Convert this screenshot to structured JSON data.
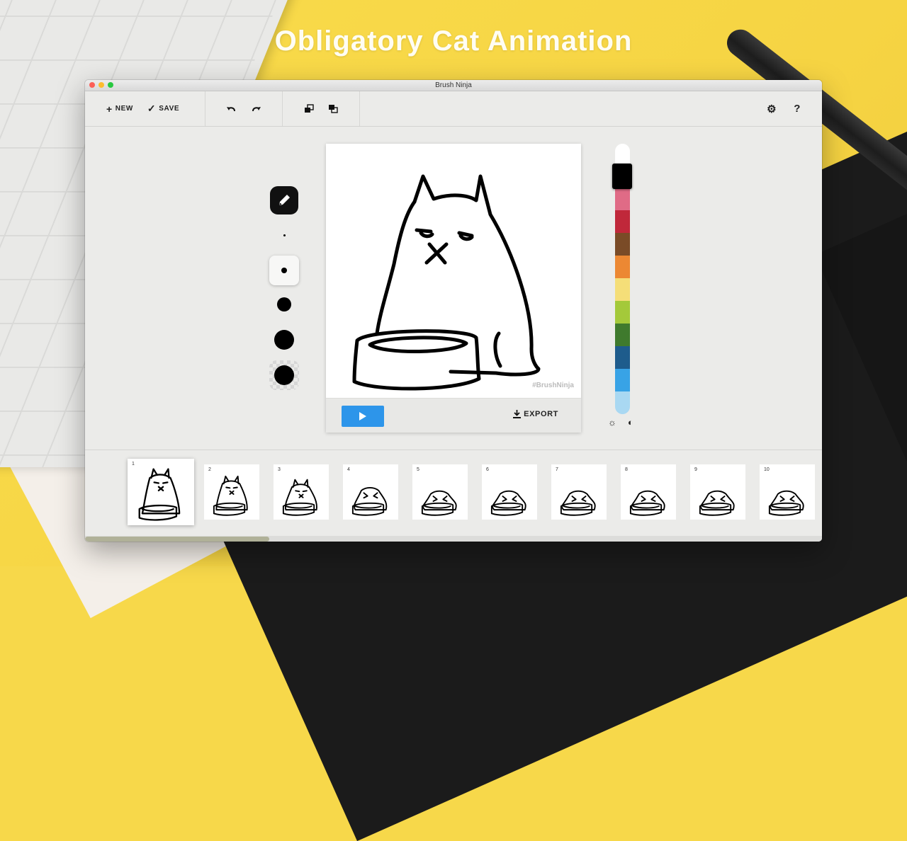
{
  "headline": "Obligatory Cat Animation",
  "window": {
    "title": "Brush Ninja"
  },
  "toolbar": {
    "new_label": "NEW",
    "save_label": "SAVE",
    "undo_icon": "undo-icon",
    "redo_icon": "redo-icon",
    "layer_back_icon": "layer-back-icon",
    "layer_front_icon": "layer-front-icon",
    "settings_icon": "gear-icon",
    "help_label": "?"
  },
  "brushes": {
    "tool": "pencil-icon",
    "sizes": [
      "tiny",
      "small",
      "medium",
      "large",
      "eraser"
    ],
    "selected_size": "small"
  },
  "canvas": {
    "watermark": "#BrushNinja",
    "export_label": "EXPORT"
  },
  "palette": {
    "colors": [
      "#000000",
      "#e06b86",
      "#c0283a",
      "#7a4b27",
      "#ec8833",
      "#f5de78",
      "#a4c93a",
      "#3f7a2d",
      "#1e5c8c",
      "#38a3e6",
      "#a9d8f2"
    ],
    "selected": "#000000",
    "brightness_icon": "sun-icon",
    "contrast_icon": "contrast-icon"
  },
  "timeline": {
    "frames": [
      {
        "number": "1"
      },
      {
        "number": "2"
      },
      {
        "number": "3"
      },
      {
        "number": "4"
      },
      {
        "number": "5"
      },
      {
        "number": "6"
      },
      {
        "number": "7"
      },
      {
        "number": "8"
      },
      {
        "number": "9"
      },
      {
        "number": "10"
      }
    ],
    "selected_frame": "1"
  }
}
